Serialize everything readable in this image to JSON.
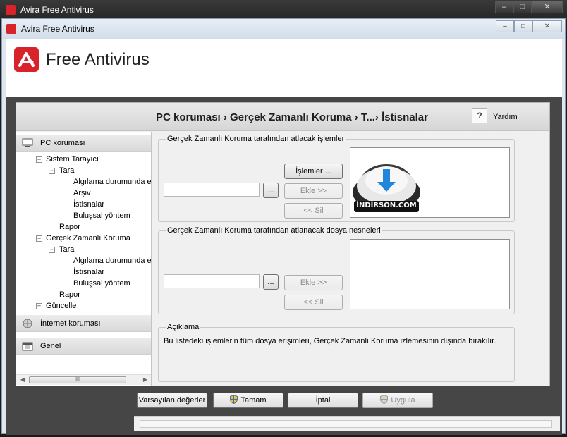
{
  "outer_window": {
    "title": "Avira Free Antivirus"
  },
  "dialog": {
    "title": "Avira Free Antivirus"
  },
  "brand": {
    "product_name": "Free Antivirus"
  },
  "header": {
    "breadcrumb": "PC koruması › Gerçek Zamanlı Koruma › T...› İstisnalar",
    "help_label": "Yardım",
    "help_icon": "?"
  },
  "nav": {
    "sections": [
      {
        "label": "PC koruması",
        "icon": "monitor-icon"
      },
      {
        "label": "İnternet koruması",
        "icon": "globe-icon"
      },
      {
        "label": "Genel",
        "icon": "calendar-icon"
      }
    ],
    "tree": [
      "Sistem Tarayıcı",
      "Tara",
      "Algılama durumunda ey",
      "Arşiv",
      "İstisnalar",
      "Buluşsal yöntem",
      "Rapor",
      "Gerçek Zamanlı Koruma",
      "Tara",
      "Algılama durumunda ey",
      "İstisnalar",
      "Buluşsal yöntem",
      "Rapor",
      "Güncelle"
    ],
    "scroll_grip": "III"
  },
  "processes_group": {
    "legend": "Gerçek Zamanlı Koruma tarafından atlacak işlemler",
    "input_value": "",
    "browse_label": "...",
    "processes_button": "İşlemler ...",
    "add_button": "Ekle >>",
    "remove_button": "<< Sil"
  },
  "files_group": {
    "legend": "Gerçek Zamanlı Koruma tarafından atlanacak dosya nesneleri",
    "input_value": "",
    "browse_label": "...",
    "add_button": "Ekle >>",
    "remove_button": "<< Sil"
  },
  "description_group": {
    "legend": "Açıklama",
    "text": "Bu listedeki işlemlerin tüm dosya erişimleri, Gerçek Zamanlı Koruma izlemesinin dışında bırakılır."
  },
  "watermark": {
    "text": "İNDİRSON.COM"
  },
  "footer": {
    "defaults_button": "Varsayılan değerler",
    "ok_button": "Tamam",
    "cancel_button": "İptal",
    "apply_button": "Uygula"
  },
  "colors": {
    "brand_red": "#d8232a",
    "dark_band": "#464646",
    "watermark_blue": "#1f86d9"
  }
}
